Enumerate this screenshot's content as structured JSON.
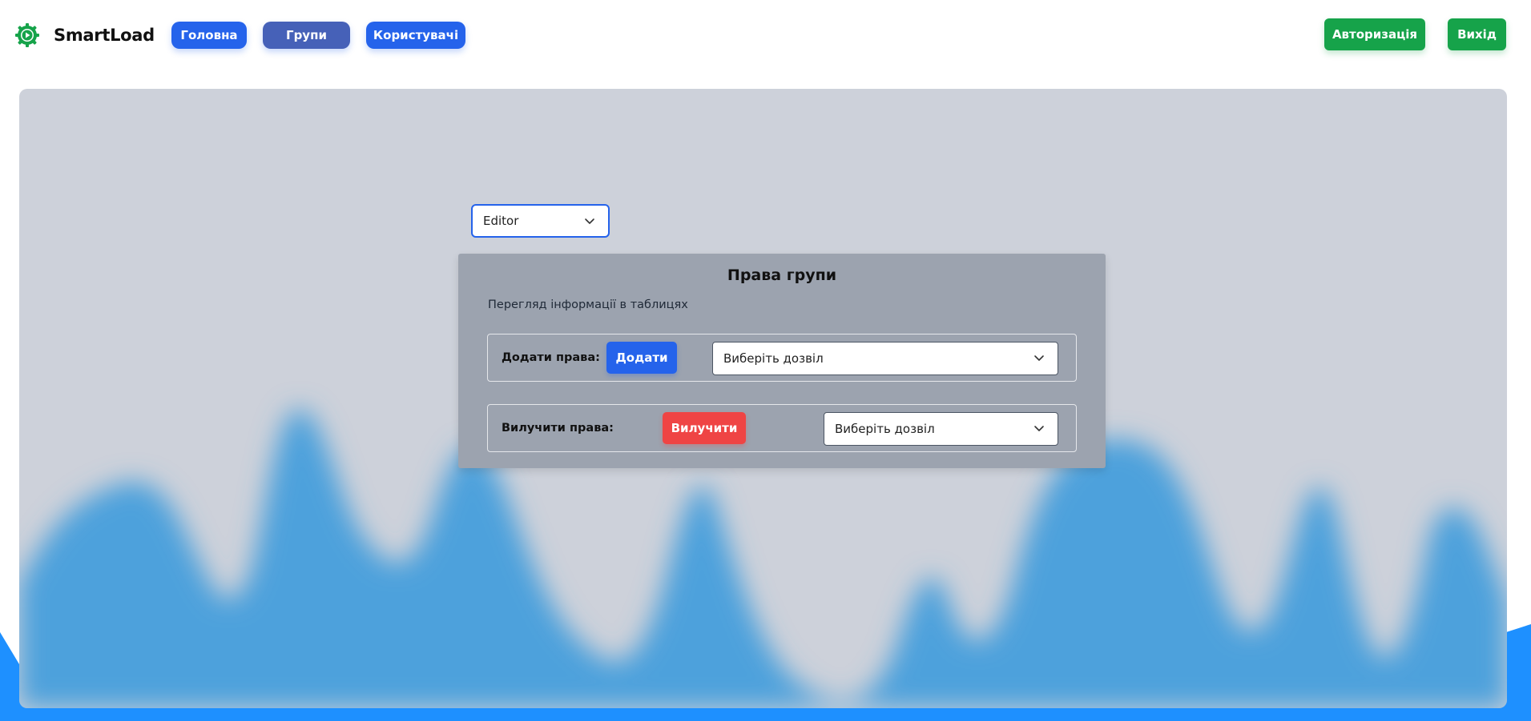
{
  "app": {
    "logo_text": "SmartLoad",
    "logo_icon": "gear-play-icon",
    "accent_color": "#16a34a"
  },
  "nav": {
    "main_label": "Головна",
    "groups_label": "Групи",
    "users_label": "Користувачі"
  },
  "top_actions": {
    "auth_label": "Авторизація",
    "exit_label": "Вихід"
  },
  "group_select": {
    "value": "Editor",
    "icon": "chevron-down-icon"
  },
  "rights_card": {
    "title": "Права групи",
    "subtitle": "Перегляд інформації в таблицях",
    "add_row": {
      "label": "Додати права:",
      "button_label": "Додати",
      "select_placeholder": "Виберіть дозвіл"
    },
    "remove_row": {
      "label": "Вилучити права:",
      "button_label": "Вилучити",
      "select_placeholder": "Виберіть дозвіл"
    }
  },
  "colors": {
    "primary": "#2563eb",
    "success": "#16a34a",
    "danger": "#ef4444",
    "panel_bg": "#cdd1da",
    "card_bg": "#9ca3af",
    "wave": "#4ea1dc"
  }
}
